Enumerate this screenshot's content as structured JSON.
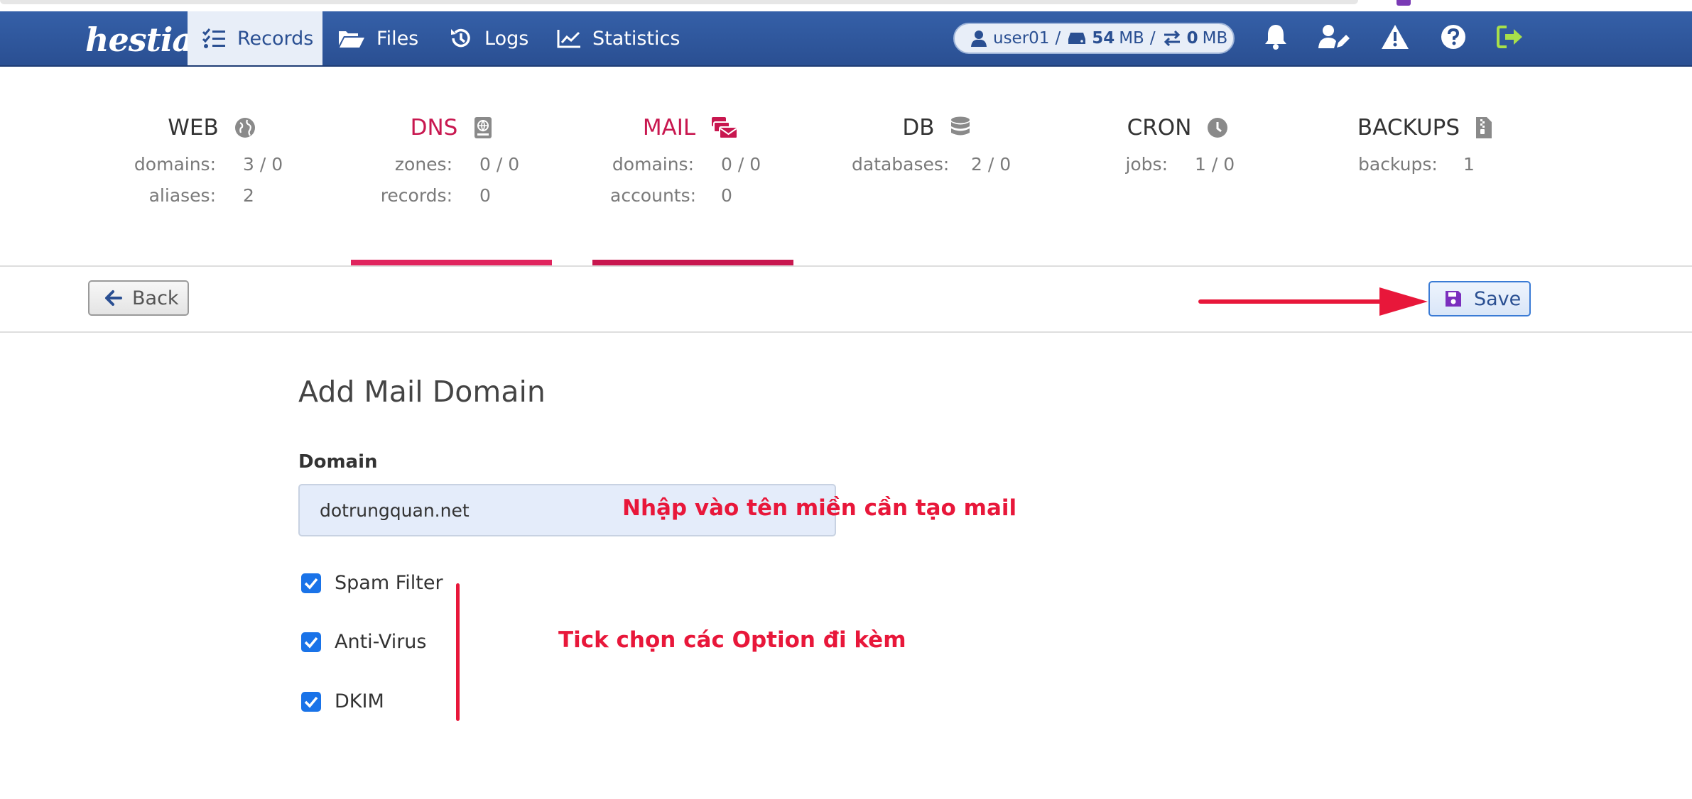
{
  "app": {
    "logo_text": "hestia",
    "nav": [
      {
        "label": "Records",
        "icon": "list-check-icon",
        "active": true
      },
      {
        "label": "Files",
        "icon": "folder-open-icon",
        "active": false
      },
      {
        "label": "Logs",
        "icon": "history-icon",
        "active": false
      },
      {
        "label": "Statistics",
        "icon": "chart-line-icon",
        "active": false
      }
    ],
    "usage": {
      "user": "user01",
      "sep1": "/",
      "disk_value": "54",
      "disk_unit": "MB",
      "sep2": "/",
      "bw_value": "0",
      "bw_unit": "MB"
    },
    "right_icons": [
      "bell-icon",
      "user-edit-icon",
      "warning-icon",
      "help-icon",
      "logout-icon"
    ],
    "accent_color": "#c8174f",
    "logout_color": "#a8e04a"
  },
  "stats": [
    {
      "title": "WEB",
      "icon": "globe-icon",
      "rows": [
        {
          "label": "domains:",
          "value": "3 / 0"
        },
        {
          "label": "aliases:",
          "value": "2"
        }
      ]
    },
    {
      "title": "DNS",
      "icon": "address-book-icon",
      "rows": [
        {
          "label": "zones:",
          "value": "0 / 0"
        },
        {
          "label": "records:",
          "value": "0"
        }
      ]
    },
    {
      "title": "MAIL",
      "icon": "mail-bulk-icon",
      "rows": [
        {
          "label": "domains:",
          "value": "0 / 0"
        },
        {
          "label": "accounts:",
          "value": "0"
        }
      ]
    },
    {
      "title": "DB",
      "icon": "database-icon",
      "rows": [
        {
          "label": "databases:",
          "value": "2 / 0"
        }
      ]
    },
    {
      "title": "CRON",
      "icon": "clock-icon",
      "rows": [
        {
          "label": "jobs:",
          "value": "1 / 0"
        }
      ]
    },
    {
      "title": "BACKUPS",
      "icon": "file-archive-icon",
      "rows": [
        {
          "label": "backups:",
          "value": "1"
        }
      ]
    }
  ],
  "toolbar": {
    "back_label": "Back",
    "save_label": "Save"
  },
  "form": {
    "title": "Add Mail Domain",
    "domain_label": "Domain",
    "domain_value": "dotrungquan.net",
    "options": [
      {
        "label": "Spam Filter",
        "checked": true
      },
      {
        "label": "Anti-Virus",
        "checked": true
      },
      {
        "label": "DKIM",
        "checked": true
      }
    ]
  },
  "annotations": {
    "domain_hint": "Nhập vào tên miền cần tạo mail",
    "options_hint": "Tick chọn các Option đi kèm",
    "color": "#e8173a"
  }
}
